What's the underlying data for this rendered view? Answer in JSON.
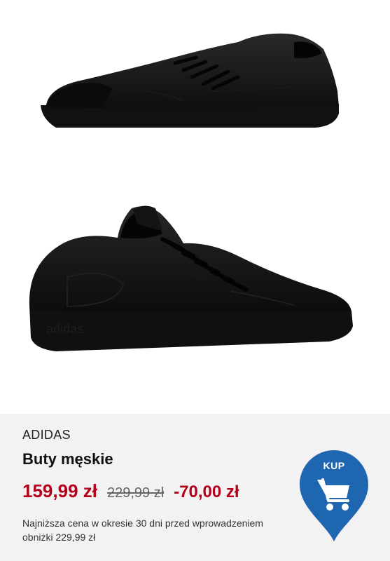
{
  "product": {
    "brand": "ADIDAS",
    "title": "Buty męskie",
    "price_current": "159,99 zł",
    "price_old": "229,99 zł",
    "discount": "-70,00 zł",
    "lowest_price_note": "Najniższa cena w okresie 30 dni przed wprowadzeniem obniżki 229,99 zł"
  },
  "buy_button": {
    "label": "KUP",
    "icon": "cart-icon",
    "color": "#1f66b1"
  },
  "colors": {
    "price_accent": "#b3001b",
    "panel_bg": "#f2f2f3"
  }
}
